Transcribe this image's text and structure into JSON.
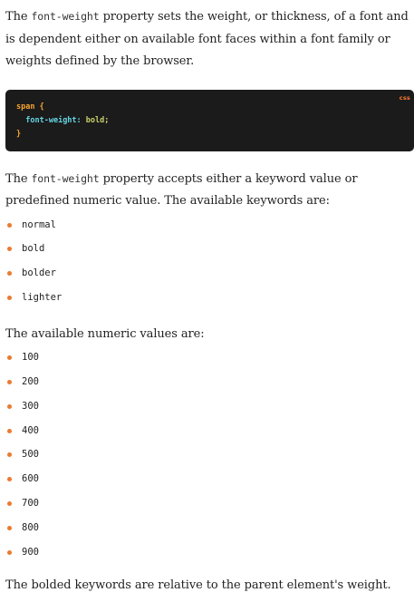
{
  "intro": {
    "prefix": "The ",
    "code": "font-weight",
    "suffix": " property sets the weight, or thickness, of a font and is dependent either on available font faces within a font family or weights defined by the browser."
  },
  "code_block": {
    "language": "css",
    "selector": "span",
    "open_brace": " {",
    "property": "font-weight",
    "colon": ": ",
    "value": "bold",
    "semicolon": ";",
    "close_brace": "}"
  },
  "keywords_intro": {
    "prefix": "The ",
    "code": "font-weight",
    "suffix": " property accepts either a keyword value or predefined numeric value. The available keywords are:"
  },
  "keywords": [
    "normal",
    "bold",
    "bolder",
    "lighter"
  ],
  "numeric_intro": "The available numeric values are:",
  "numeric_values": [
    "100",
    "200",
    "300",
    "400",
    "500",
    "600",
    "700",
    "800",
    "900"
  ],
  "cut_text": "The bolded keywords are relative to the parent element's weight."
}
